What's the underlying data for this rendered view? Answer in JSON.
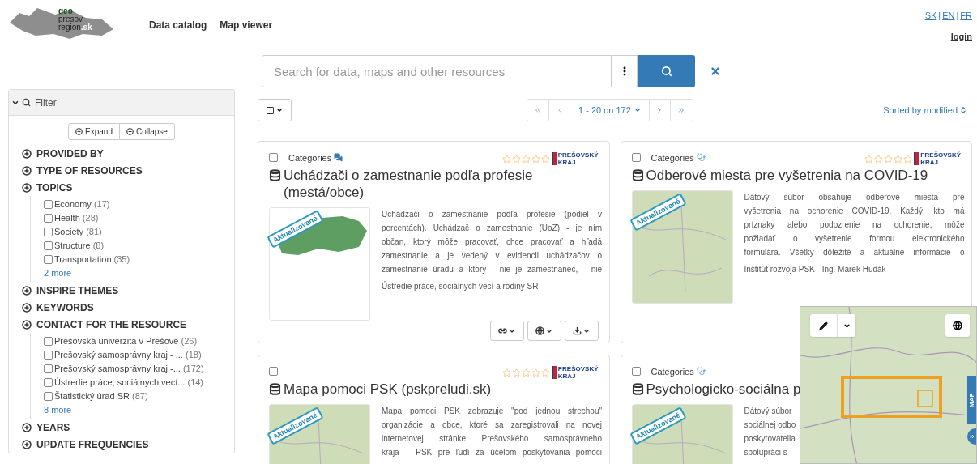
{
  "logo": {
    "line_1": "geo",
    "line_2": "presov",
    "line_3": "region",
    "suffix": ".sk"
  },
  "nav": [
    "Data catalog",
    "Map viewer"
  ],
  "languages": [
    {
      "label": "SK",
      "selected": false,
      "separator": "|"
    },
    {
      "label": "EN",
      "selected": false,
      "separator": "|"
    },
    {
      "label": "FR",
      "selected": false
    }
  ],
  "login": "login",
  "search": {
    "placeholder": "Search for data, maps and other resources"
  },
  "filter": {
    "title": "Filter",
    "expanded": true,
    "expand_button": "Expand",
    "collapse_button": "Collapse",
    "sections": [
      {
        "label": "PROVIDED BY",
        "expanded": false
      },
      {
        "label": "TYPE OF RESOURCES",
        "expanded": false
      },
      {
        "label": "TOPICS",
        "expanded": true,
        "items": [
          {
            "label": "Economy",
            "count": "(17)",
            "checked": false
          },
          {
            "label": "Health",
            "count": "(28)",
            "checked": false
          },
          {
            "label": "Society",
            "count": "(81)",
            "checked": false
          },
          {
            "label": "Structure",
            "count": "(8)",
            "checked": false
          },
          {
            "label": "Transportation",
            "count": "(35)",
            "checked": false
          }
        ],
        "more": "2 more"
      },
      {
        "label": "INSPIRE THEMES",
        "expanded": false
      },
      {
        "label": "KEYWORDS",
        "expanded": false
      },
      {
        "label": "CONTACT FOR THE RESOURCE",
        "expanded": true,
        "items": [
          {
            "label": "Prešovská univerzita v Prešove",
            "count": "(26)",
            "checked": false
          },
          {
            "label": "Prešovský samosprávny kraj - ...",
            "count": "(18)",
            "checked": false
          },
          {
            "label": "Prešovský samosprávny kraj -...",
            "count": "(172)",
            "checked": false
          },
          {
            "label": "Ústredie práce, sociálnych vecí...",
            "count": "(14)",
            "checked": false
          },
          {
            "label": "Štatistický úrad SR",
            "count": "(87)",
            "checked": false
          }
        ],
        "more": "8 more"
      },
      {
        "label": "YEARS",
        "expanded": false
      },
      {
        "label": "UPDATE FREQUENCIES",
        "expanded": false
      }
    ]
  },
  "pagination": {
    "range": "1 - 20 on 172"
  },
  "sort": "Sorted by modified",
  "results": [
    {
      "category": {
        "label": "Categories",
        "kind": "comments"
      },
      "stars": 0,
      "publisher_logo": [
        "PREŠOVSKÝ",
        "KRAJ"
      ],
      "title": "Uchádzači o zamestnanie podľa profesie (mestá/obce)",
      "thumbnail": {
        "kind": "region",
        "badge": "Aktualizované"
      },
      "checked": false,
      "description": [
        "Uchádzači o zamestnanie podľa profesie (podiel v",
        "percentách). Uchádzač o zamestnanie (UoZ) - je ním",
        "občan, ktorý môže pracovať, chce pracovať a hľadá",
        "zamestnanie a je vedený v evidencii uchádzačov o",
        "zamestnanie úradu a ktorý - nie je zamestnanec, - nie"
      ],
      "organization": "Ústredie práce, sociálnych vecí a rodiny SR",
      "actions": [
        {
          "kind": "link"
        },
        {
          "kind": "globe"
        },
        {
          "kind": "download"
        }
      ]
    },
    {
      "category": {
        "label": "Categories",
        "kind": "health"
      },
      "stars": 0,
      "publisher_logo": [
        "PREŠOVSKÝ",
        "KRAJ"
      ],
      "title": "Odberové miesta pre vyšetrenia na COVID-19",
      "thumbnail": {
        "kind": "topographic",
        "badge": "Aktualizované"
      },
      "checked": false,
      "description": [
        "Dátový súbor obsahuje odberové miesta pre",
        "vyšetrenia na ochorenie COVID-19. Každý, kto má",
        "príznaky alebo podozrenie na ochorenie, môže",
        "požiadať o vyšetrenie formou elektronického",
        "formulára. Všetky dôležité a aktuálne informácie o"
      ],
      "organization": "Inštitút rozvoja PSK - Ing. Marek Hudák"
    },
    {
      "stars": 0,
      "publisher_logo": [
        "PREŠOVSKÝ",
        "KRAJ"
      ],
      "title": "Mapa pomoci PSK (pskpreludi.sk)",
      "thumbnail": {
        "kind": "topographic",
        "badge": "Aktualizované"
      },
      "checked": false,
      "description": [
        "Mapa pomoci PSK zobrazuje \"pod jednou strechou\"",
        "organizácie a obce, ktoré sa zaregistrovali na novej",
        "internetovej stránke Prešovského samosprávneho",
        "kraja – PSK pre ľudí za účelom poskytovania pomoci"
      ]
    },
    {
      "category": {
        "label": "Categories",
        "kind": "health"
      },
      "title": "Psychologicko-sociálna p",
      "thumbnail": {
        "kind": "topographic",
        "badge": "Aktualizované"
      },
      "checked": false,
      "description": [
        "Dátový súbor",
        "sociálnej odbo",
        "poskytovatelia",
        "spolupráci s"
      ]
    }
  ],
  "map_panel": {
    "side_tab": "MAP"
  }
}
